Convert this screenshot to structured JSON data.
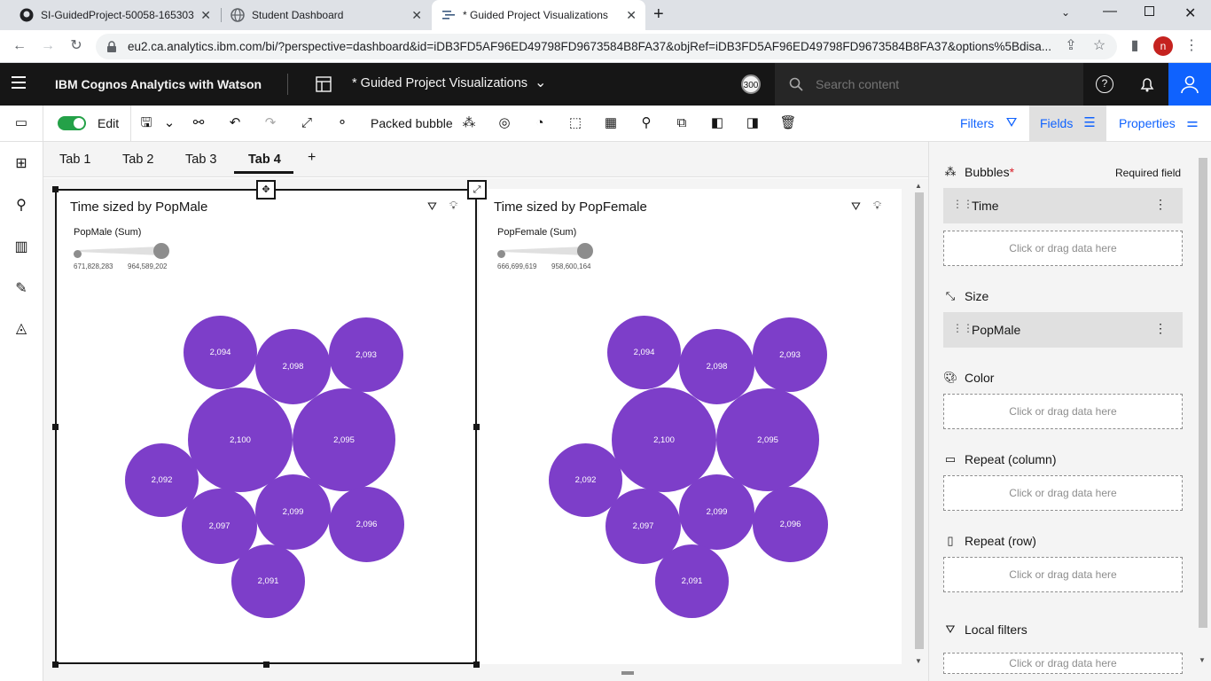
{
  "browser": {
    "tabs": [
      {
        "title": "SI-GuidedProject-50058-165303",
        "icon": "github-icon"
      },
      {
        "title": "Student Dashboard",
        "icon": "globe-icon"
      },
      {
        "title": "* Guided Project Visualizations",
        "icon": "cognos-icon"
      }
    ],
    "url": "eu2.ca.analytics.ibm.com/bi/?perspective=dashboard&id=iDB3FD5AF96ED49798FD9673584B8FA37&objRef=iDB3FD5AF96ED49798FD9673584B8FA37&options%5Bdisa..."
  },
  "header": {
    "brand": "IBM Cognos Analytics with Watson",
    "doc_title": "* Guided Project Visualizations",
    "badge": "300",
    "search_placeholder": "Search content"
  },
  "toolbar": {
    "edit_label": "Edit",
    "viz_type": "Packed bubble",
    "filters_label": "Filters",
    "fields_label": "Fields",
    "properties_label": "Properties"
  },
  "dash_tabs": [
    "Tab 1",
    "Tab 2",
    "Tab 3",
    "Tab 4"
  ],
  "active_tab": "Tab 4",
  "widgets": [
    {
      "title": "Time sized by PopMale",
      "legend_title": "PopMale (Sum)",
      "legend_min": "671,828,283",
      "legend_max": "964,589,202",
      "bubbles": [
        "2,094",
        "2,098",
        "2,093",
        "2,100",
        "2,095",
        "2,092",
        "2,099",
        "2,097",
        "2,096",
        "2,091"
      ]
    },
    {
      "title": "Time sized by PopFemale",
      "legend_title": "PopFemale (Sum)",
      "legend_min": "666,699,619",
      "legend_max": "958,600,164",
      "bubbles": [
        "2,094",
        "2,098",
        "2,093",
        "2,100",
        "2,095",
        "2,092",
        "2,099",
        "2,097",
        "2,096",
        "2,091"
      ]
    }
  ],
  "panel": {
    "bubbles_label": "Bubbles",
    "required_mark": "*",
    "required_text": "Required field",
    "bubbles_field": "Time",
    "size_label": "Size",
    "size_field": "PopMale",
    "color_label": "Color",
    "repeat_col_label": "Repeat (column)",
    "repeat_row_label": "Repeat (row)",
    "local_filters_label": "Local filters",
    "dropzone_text": "Click or drag data here"
  },
  "colors": {
    "bubble": "#7d3ec9",
    "toggle_on": "#24a148",
    "accent": "#0f62fe"
  }
}
